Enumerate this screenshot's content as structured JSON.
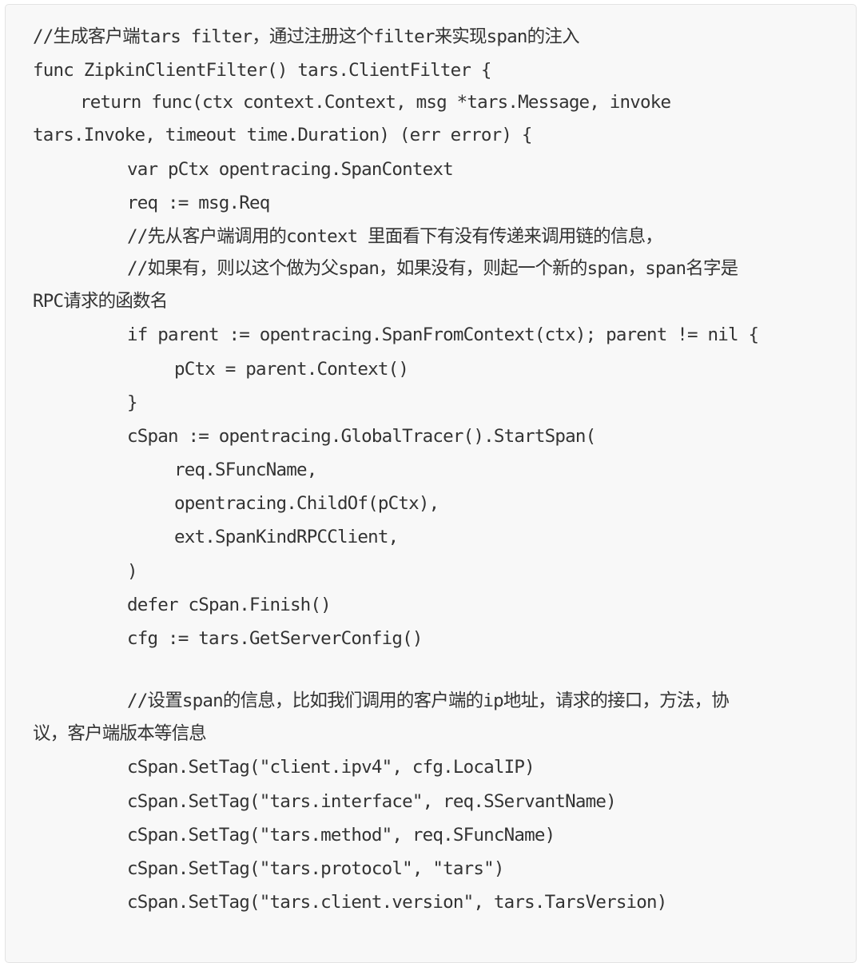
{
  "code_block": {
    "language": "go",
    "lines": [
      {
        "indent": 0,
        "text": "//生成客户端tars filter，通过注册这个filter来实现span的注入"
      },
      {
        "indent": 0,
        "text": "func ZipkinClientFilter() tars.ClientFilter {"
      },
      {
        "indent": 1,
        "text": "return func(ctx context.Context, msg *tars.Message, invoke"
      },
      {
        "indent": 0,
        "text": "tars.Invoke, timeout time.Duration) (err error) {"
      },
      {
        "indent": 2,
        "text": "var pCtx opentracing.SpanContext"
      },
      {
        "indent": 2,
        "text": "req := msg.Req"
      },
      {
        "indent": 2,
        "text": "//先从客户端调用的context 里面看下有没有传递来调用链的信息，"
      },
      {
        "indent": 2,
        "text": "//如果有，则以这个做为父span，如果没有，则起一个新的span，span名字是"
      },
      {
        "indent": 0,
        "text": "RPC请求的函数名"
      },
      {
        "indent": 2,
        "text": "if parent := opentracing.SpanFromContext(ctx); parent != nil {"
      },
      {
        "indent": 3,
        "text": "pCtx = parent.Context()"
      },
      {
        "indent": 2,
        "text": "}"
      },
      {
        "indent": 2,
        "text": "cSpan := opentracing.GlobalTracer().StartSpan("
      },
      {
        "indent": 3,
        "text": "req.SFuncName,"
      },
      {
        "indent": 3,
        "text": "opentracing.ChildOf(pCtx),"
      },
      {
        "indent": 3,
        "text": "ext.SpanKindRPCClient,"
      },
      {
        "indent": 2,
        "text": ")"
      },
      {
        "indent": 2,
        "text": "defer cSpan.Finish()"
      },
      {
        "indent": 2,
        "text": "cfg := tars.GetServerConfig()"
      },
      {
        "indent": 0,
        "text": ""
      },
      {
        "indent": 2,
        "text": "//设置span的信息，比如我们调用的客户端的ip地址，请求的接口，方法，协"
      },
      {
        "indent": 0,
        "text": "议，客户端版本等信息"
      },
      {
        "indent": 2,
        "text": "cSpan.SetTag(\"client.ipv4\", cfg.LocalIP)"
      },
      {
        "indent": 2,
        "text": "cSpan.SetTag(\"tars.interface\", req.SServantName)"
      },
      {
        "indent": 2,
        "text": "cSpan.SetTag(\"tars.method\", req.SFuncName)"
      },
      {
        "indent": 2,
        "text": "cSpan.SetTag(\"tars.protocol\", \"tars\")"
      },
      {
        "indent": 2,
        "text": "cSpan.SetTag(\"tars.client.version\", tars.TarsVersion)"
      }
    ]
  }
}
